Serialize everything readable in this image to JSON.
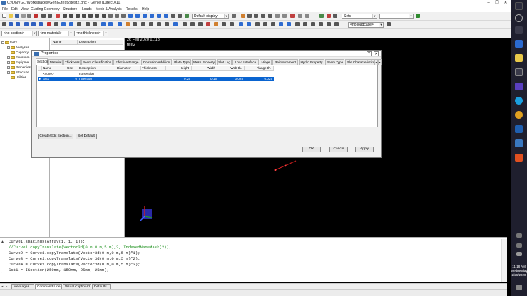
{
  "window": {
    "title": "C:/DNVGL/Workspaces/GeniE/test2/test2.gnx - Genie (DirectX11)",
    "controls": {
      "minimize": "–",
      "maximize": "❐",
      "close": "✕"
    }
  },
  "menubar": {
    "items": [
      "File",
      "Edit",
      "View",
      "Guiding Geometry",
      "Structure",
      "Loads",
      "Mesh & Analysis",
      "Results",
      "Help"
    ]
  },
  "toolbar": {
    "display_combo": "Default display",
    "sets_combo": "Sets",
    "set_value_combo": "",
    "loadcase_combo": "<no loadcase>",
    "section_combo": "<no section>",
    "material_combo": "<no material>",
    "thickness_combo": "<no thickness>"
  },
  "tree": {
    "root": "test2",
    "items": [
      "Analyses",
      "Capacity...",
      "Environm...",
      "Equipme...",
      "Properties",
      "Structure",
      "Utilities"
    ]
  },
  "midpane": {
    "headers": [
      "Name",
      "Description"
    ]
  },
  "viewport": {
    "date": "26 Feb 2020 11:18",
    "model_name": "test2"
  },
  "dialog": {
    "title": "Properties",
    "help_button": "?",
    "close_button": "✕",
    "tabs": [
      "Section",
      "Material",
      "Thickness",
      "Beam Classification",
      "Effective Flange",
      "Corrosion Addition",
      "Plate Type",
      "Mesh Property",
      "Slot Lug",
      "Load Interface",
      "Hinge",
      "Reinforcement",
      "Hydro Property",
      "Beam Type",
      "Pile Characteristics"
    ],
    "tab_scroll_left": "◂",
    "tab_scroll_right": "▸",
    "grid": {
      "headers": [
        "Name",
        "Use",
        "Description",
        "Diameter",
        "Thickness",
        "Height",
        "Width",
        "Web th.",
        "Flange th."
      ],
      "rows": [
        {
          "marker": "",
          "name": "<none>",
          "use": "",
          "description": "no section",
          "diameter": "",
          "thickness": "",
          "height": "",
          "width": "",
          "web": "",
          "flange": ""
        },
        {
          "marker": "▶",
          "name": "Sct1",
          "use": "0",
          "description": "I Section",
          "diameter": "",
          "thickness": "",
          "height": "0.25",
          "width": "0.15",
          "web": "0.025",
          "flange": "0.025"
        }
      ]
    },
    "buttons": {
      "create_edit": "Create/Edit Section...",
      "set_default": "Set Default",
      "ok": "OK",
      "cancel": "Cancel",
      "apply": "Apply"
    }
  },
  "command_line": {
    "lines": [
      "Curve1.spacings(Array(1, 1, 1));",
      "//Curve1.copyTranslate(Vector3d(0 m,0 m,5 m),3, IndexedNameMask(2));",
      "Curve2 = Curve1.copyTranslate(Vector3d(0 m,0 m,5 m)*1);",
      "Curve3 = Curve1.copyTranslate(Vector3d(0 m,0 m,5 m)*2);",
      "Curve4 = Curve1.copyTranslate(Vector3d(0 m,0 m,5 m)*3);",
      "Sct1 = ISection(250mm, 150mm, 25mm, 25mm);"
    ]
  },
  "bottom_tabs": [
    "Messages",
    "Command Line",
    "Visual Clipboard",
    "Defaults"
  ],
  "taskbar": {
    "time": "11:18 AM",
    "day": "Wednesday",
    "date": "2/26/2020"
  },
  "colors": {
    "selection": "#0a64d0",
    "comment": "#1a8f1a",
    "viewport_bg": "#000000"
  }
}
